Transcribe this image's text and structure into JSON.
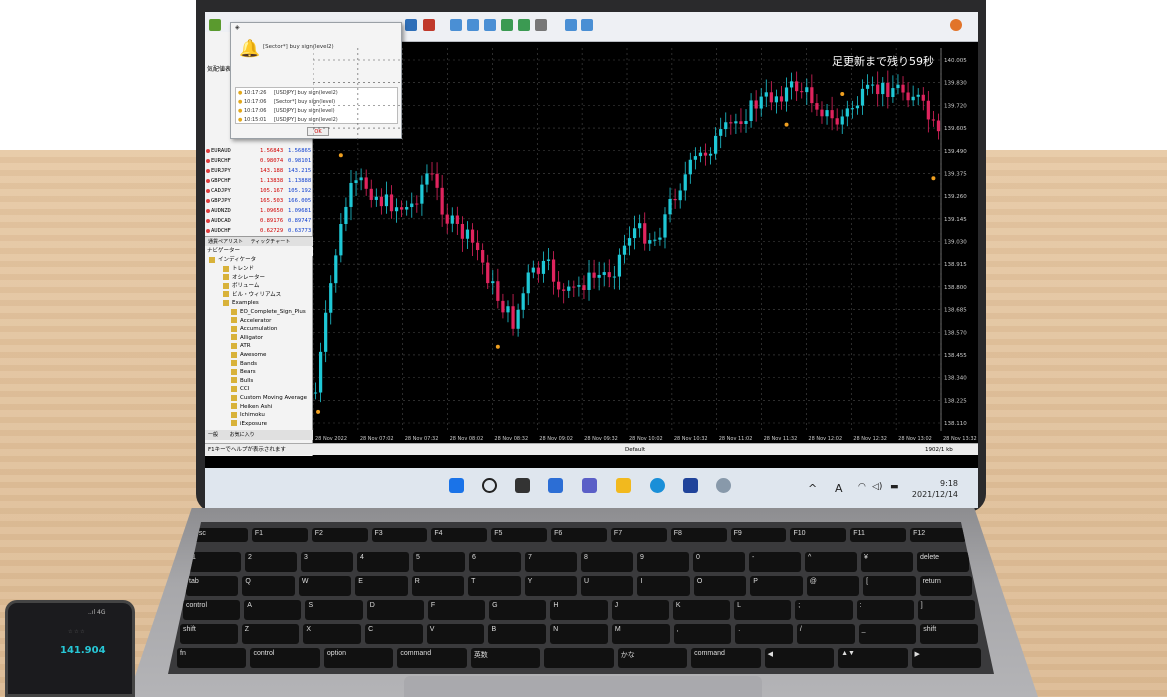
{
  "alert": {
    "message": "[Sector*] buy sign(level2)",
    "rows": [
      {
        "time": "10:17:26",
        "text": "[USDJPY] buy sign(level2)"
      },
      {
        "time": "10:17:06",
        "text": "[Sector*] buy sign(level)"
      },
      {
        "time": "10:17:06",
        "text": "[USDJPY] buy sign(level)"
      },
      {
        "time": "10:15:01",
        "text": "[USDJPY] buy sign(level2)"
      }
    ],
    "ok_label": "OK"
  },
  "chart": {
    "countdown": "足更新まで残り59秒",
    "price_labels": [
      "140.005",
      "139.830",
      "139.720",
      "139.605",
      "139.490",
      "139.375",
      "139.260",
      "139.145",
      "139.030",
      "138.915",
      "138.800",
      "138.685",
      "138.570",
      "138.455",
      "138.340",
      "138.225",
      "138.110"
    ],
    "time_labels": [
      "28 Nov 2022",
      "28 Nov 07:02",
      "28 Nov 07:32",
      "28 Nov 08:02",
      "28 Nov 08:32",
      "28 Nov 09:02",
      "28 Nov 09:32",
      "28 Nov 10:02",
      "28 Nov 10:32",
      "28 Nov 11:02",
      "28 Nov 11:32",
      "28 Nov 12:02",
      "28 Nov 12:32",
      "28 Nov 13:02",
      "28 Nov 13:32"
    ],
    "colors": {
      "up": "#1fc8d6",
      "down": "#e0245e",
      "grid": "#4a4a4a"
    }
  },
  "market_watch": {
    "header": "気配値表示",
    "rows": [
      {
        "sym": "EURAUD",
        "bid": "1.56843",
        "ask": "1.56865"
      },
      {
        "sym": "EURCHF",
        "bid": "0.98074",
        "ask": "0.98101"
      },
      {
        "sym": "EURJPY",
        "bid": "143.188",
        "ask": "143.215"
      },
      {
        "sym": "GBPCHF",
        "bid": "1.13838",
        "ask": "1.13888"
      },
      {
        "sym": "CADJPY",
        "bid": "105.167",
        "ask": "105.192"
      },
      {
        "sym": "GBPJPY",
        "bid": "165.503",
        "ask": "166.005"
      },
      {
        "sym": "AUDNZD",
        "bid": "1.09650",
        "ask": "1.09681"
      },
      {
        "sym": "AUDCAD",
        "bid": "0.89176",
        "ask": "0.89747"
      },
      {
        "sym": "AUDCHF",
        "bid": "0.62729",
        "ask": "0.63773"
      }
    ],
    "tabs": [
      "通貨ペアリスト",
      "ティックチャート"
    ]
  },
  "navigator": {
    "header": "ナビゲーター",
    "root": "インディケータ",
    "items": [
      "トレンド",
      "オシレーター",
      "ボリューム",
      "ビル・ウィリアムス",
      "Examples",
      "EO_Complete_Sign_Plus",
      "Accelerator",
      "Accumulation",
      "Alligator",
      "ATR",
      "Awesome",
      "Bands",
      "Bears",
      "Bulls",
      "CCI",
      "Custom Moving Average",
      "Heiken Ashi",
      "Ichimoku",
      "iExposure"
    ],
    "tabs": [
      "一般",
      "お気に入り"
    ]
  },
  "statusbar": {
    "help": "F1キーでヘルプが表示されます",
    "profile": "Default",
    "traffic": "1902/1 kb"
  },
  "taskbar": {
    "time": "9:18",
    "date": "2021/12/14",
    "ime": "A"
  },
  "phone": {
    "status": "..ıl 4G",
    "price": "141.904"
  }
}
